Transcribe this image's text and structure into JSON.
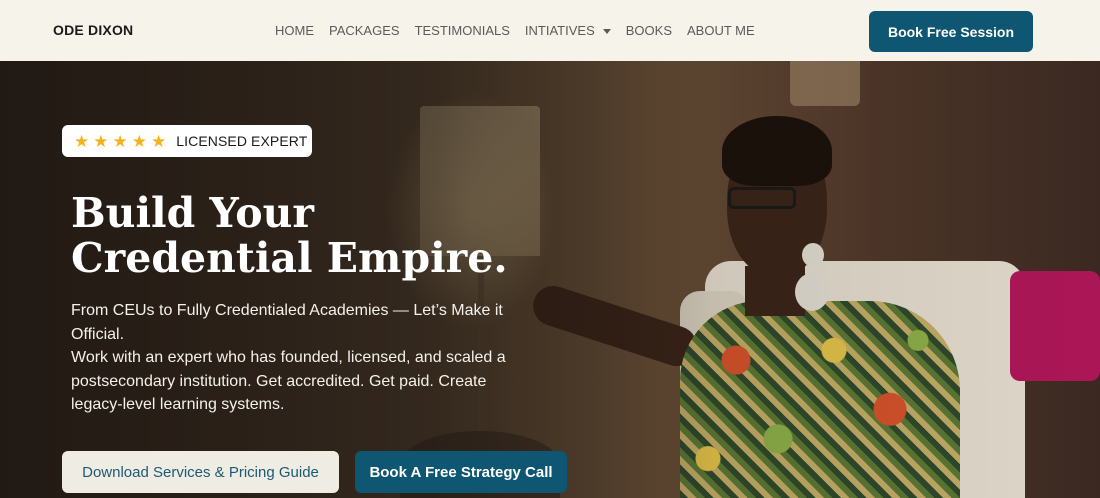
{
  "header": {
    "logo": "ODE DIXON",
    "nav": [
      {
        "label": "HOME"
      },
      {
        "label": "PACKAGES"
      },
      {
        "label": "TESTIMONIALS"
      },
      {
        "label": "INTIATIVES"
      },
      {
        "label": "BOOKS"
      },
      {
        "label": "ABOUT ME"
      }
    ],
    "cta_label": "Book Free Session"
  },
  "hero": {
    "badge": {
      "stars": 5,
      "star_icon": "star-icon",
      "text": "LICENSED EXPERT"
    },
    "headline_line1": "Build Your",
    "headline_line2": "Credential Empire.",
    "subtext_line1": "From CEUs to Fully Credentialed Academies — Let’s Make it Official.",
    "subtext_line2": "Work with an expert who has founded, licensed, and scaled a postsecondary institution. Get accredited. Get paid. Create legacy-level learning systems.",
    "primary_button": "Download Services & Pricing Guide",
    "secondary_button": "Book A Free Strategy Call"
  },
  "colors": {
    "accent": "#0e5672",
    "header_bg": "#f6f3ea",
    "star": "#f3b31b"
  }
}
